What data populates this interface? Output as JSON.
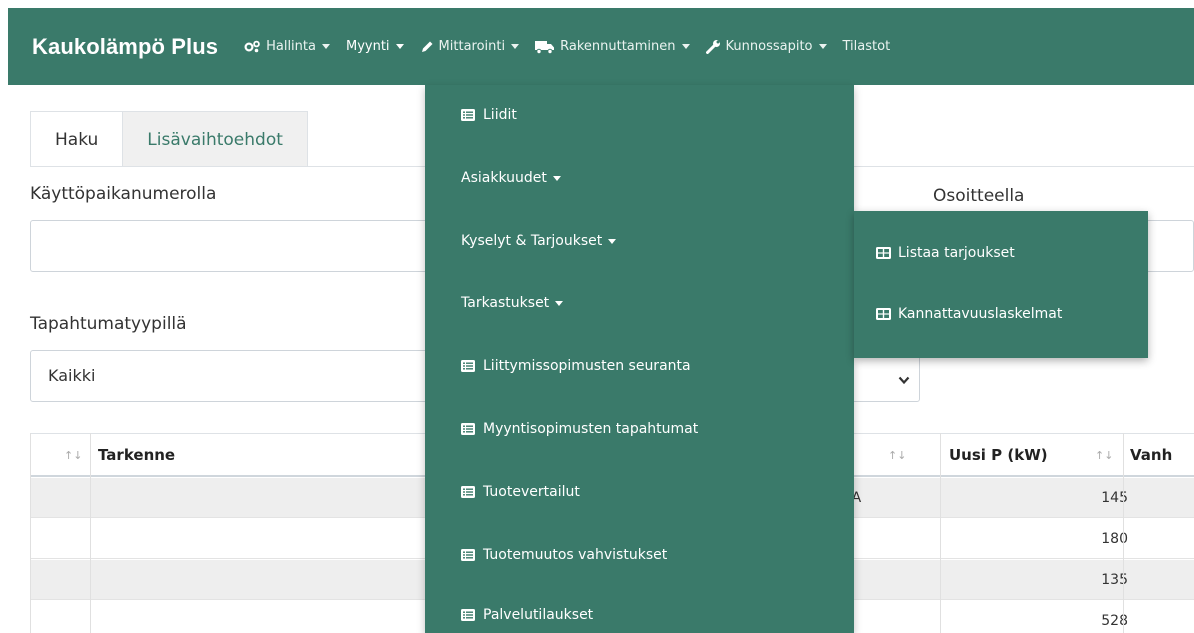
{
  "navbar": {
    "brand": "Kaukolämpö Plus",
    "items": [
      {
        "label": "Hallinta",
        "icon": "cogs-icon"
      },
      {
        "label": "Myynti",
        "icon": ""
      },
      {
        "label": "Mittarointi",
        "icon": "pencil-icon"
      },
      {
        "label": "Rakennuttaminen",
        "icon": "truck-icon"
      },
      {
        "label": "Kunnossapito",
        "icon": "wrench-icon"
      },
      {
        "label": "Tilastot",
        "icon": ""
      }
    ]
  },
  "tabs": [
    {
      "label": "Haku"
    },
    {
      "label": "Lisävaihtoehdot"
    }
  ],
  "form": {
    "kayttopaikka_label": "Käyttöpaikanumerolla",
    "osoite_label": "Osoitteella",
    "tapahtuma_label": "Tapahtumatyypillä",
    "tapahtuma_value": "Kaikki"
  },
  "table": {
    "headers": {
      "tarkenne": "Tarkenne",
      "uusi_p": "Uusi P (kW)",
      "vanha": "Vanh"
    },
    "rows": [
      {
        "address_fragment": "u 7 A",
        "uusi_p": "145"
      },
      {
        "address_fragment": "",
        "uusi_p": "180"
      },
      {
        "address_fragment": "",
        "uusi_p": "135"
      },
      {
        "address_fragment": "",
        "uusi_p": "528"
      }
    ]
  },
  "dropdown": {
    "items": [
      {
        "label": "Liidit"
      },
      {
        "label": "Asiakkuudet"
      },
      {
        "label": "Kyselyt & Tarjoukset"
      },
      {
        "label": "Tarkastukset"
      },
      {
        "label": "Liittymissopimusten seuranta"
      },
      {
        "label": "Myyntisopimusten tapahtumat"
      },
      {
        "label": "Tuotevertailut"
      },
      {
        "label": "Tuotemuutos vahvistukset"
      },
      {
        "label": "Palvelutilaukset"
      }
    ]
  },
  "submenu": {
    "items": [
      {
        "label": "Listaa tarjoukset"
      },
      {
        "label": "Kannattavuuslaskelmat"
      }
    ]
  },
  "colors": {
    "primary": "#3a7a6a",
    "header_bg": "#eeeeee"
  }
}
